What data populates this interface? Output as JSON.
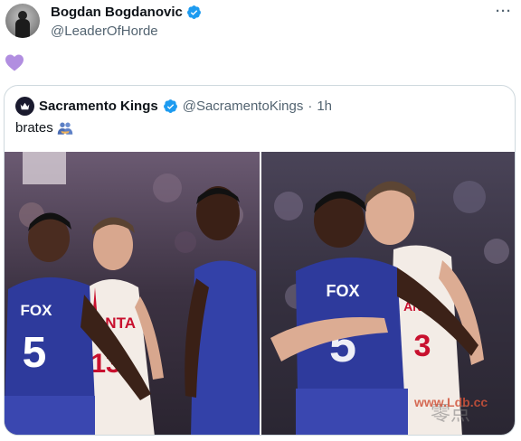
{
  "author": {
    "display_name": "Bogdan Bogdanovic",
    "handle": "@LeaderOfHorde",
    "verified": true
  },
  "post": {
    "reaction_icon": "purple-heart-icon",
    "more_icon": "more-options-icon",
    "more_label": "···"
  },
  "quoted_post": {
    "display_name": "Sacramento Kings",
    "handle": "@SacramentoKings",
    "separator": "·",
    "time": "1h",
    "text": "brates",
    "emoji_icon": "people-hugging-icon",
    "verified": true
  },
  "photos": [
    {
      "jerseys": [
        {
          "name": "FOX",
          "number": "5"
        },
        {
          "name": "ANTA",
          "number": "13"
        }
      ]
    },
    {
      "jerseys": [
        {
          "name": "FOX",
          "number": "5"
        },
        {
          "name": "ANTA",
          "number": "3"
        }
      ]
    }
  ],
  "watermark": {
    "text": "www.Ldb.cc",
    "chars": "零点"
  },
  "colors": {
    "verified_blue": "#1d9bf0",
    "heart_purple": "#b18ee0",
    "kings_purple": "#2e3a9c",
    "hawks_red": "#c8102e",
    "text_primary": "#0f1419",
    "text_secondary": "#536471",
    "border": "#cfd9de"
  }
}
